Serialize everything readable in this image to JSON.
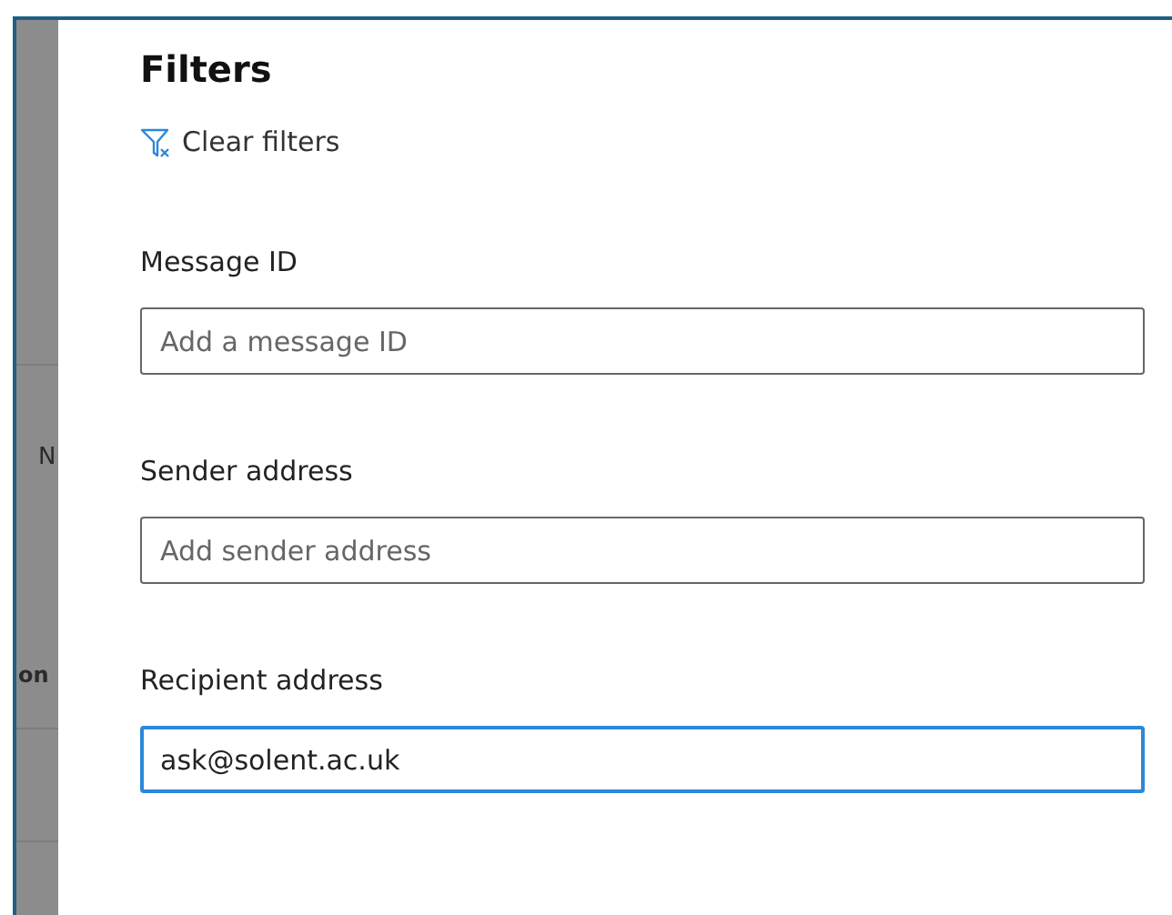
{
  "background_fragments": [
    "N",
    "on"
  ],
  "panel": {
    "title": "Filters",
    "clear_link": "Clear filters",
    "fields": [
      {
        "label": "Message ID",
        "placeholder": "Add a message ID",
        "focused": false
      },
      {
        "label": "Sender address",
        "placeholder": "Add sender address",
        "focused": false
      },
      {
        "label": "Recipient address",
        "value": "ask@solent.ac.uk",
        "focused": true
      }
    ]
  }
}
